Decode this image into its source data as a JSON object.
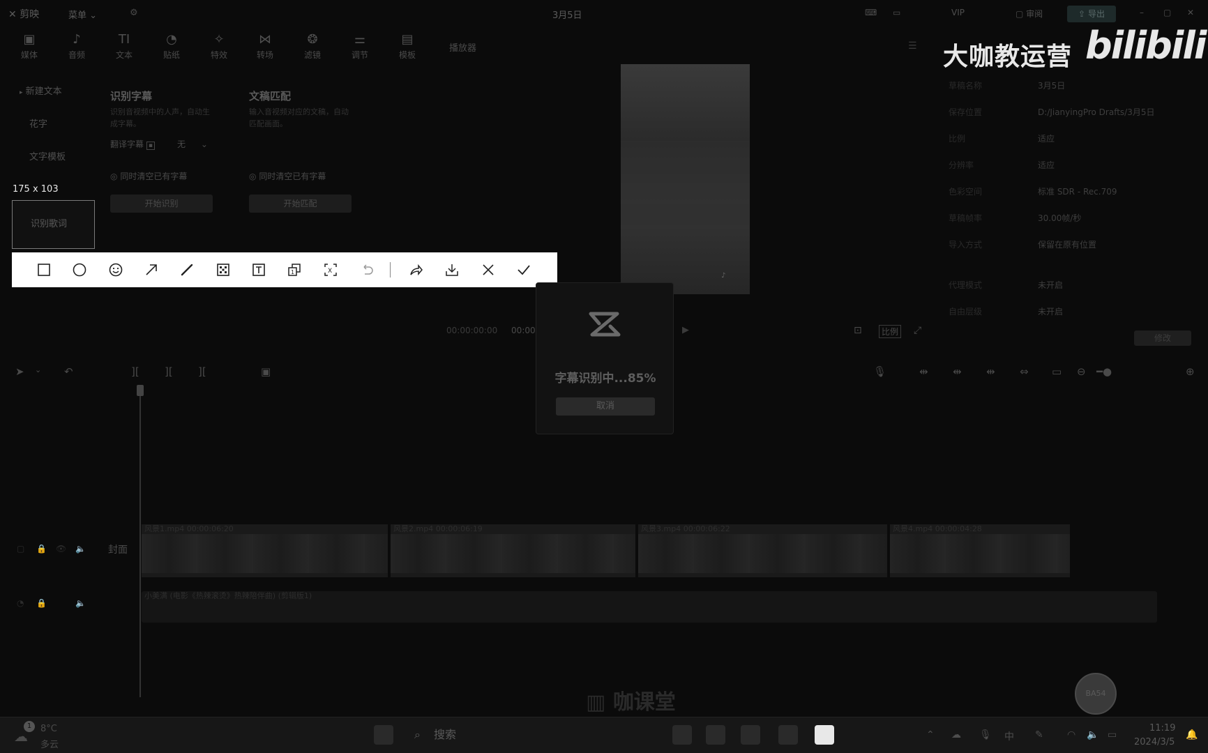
{
  "topbar": {
    "app_name": "剪映",
    "menu": "菜单",
    "title": "3月5日",
    "vip": "VIP",
    "review": "审阅",
    "export": "导出"
  },
  "tool_tabs": [
    {
      "label": "媒体",
      "glyph": "▣"
    },
    {
      "label": "音频",
      "glyph": "♪"
    },
    {
      "label": "文本",
      "glyph": "TI"
    },
    {
      "label": "贴纸",
      "glyph": "◔"
    },
    {
      "label": "特效",
      "glyph": "✧"
    },
    {
      "label": "转场",
      "glyph": "⋈"
    },
    {
      "label": "滤镜",
      "glyph": "❂"
    },
    {
      "label": "调节",
      "glyph": "⚌"
    },
    {
      "label": "模板",
      "glyph": "▤"
    }
  ],
  "player_label": "播放器",
  "left_nav": {
    "new_text": "新建文本",
    "fancy_text": "花字",
    "text_template": "文字模板",
    "lyrics": "识别歌词"
  },
  "screenshot": {
    "size_label": "175 x 103"
  },
  "subtitle_panel": {
    "title": "识别字幕",
    "desc": "识别音视频中的人声，自动生成字幕。",
    "translate_label": "翻译字幕",
    "translate_value": "无",
    "clear_label": "同时清空已有字幕",
    "start_btn": "开始识别"
  },
  "manuscript_panel": {
    "title": "文稿匹配",
    "desc": "输入音视频对应的文稿，自动匹配画面。",
    "clear_label": "同时清空已有字幕",
    "start_btn": "开始匹配"
  },
  "player": {
    "time_current": "00:00:00:00",
    "time_total": "00:00",
    "ratio": "比例"
  },
  "watermark": {
    "text": "大咖教运营",
    "logo": "bilibili",
    "bottom": "咖课堂"
  },
  "info_panel": {
    "rows": [
      {
        "key": "草稿名称",
        "value": "3月5日"
      },
      {
        "key": "保存位置",
        "value": "D:/JianyingPro Drafts/3月5日"
      },
      {
        "key": "比例",
        "value": "适应"
      },
      {
        "key": "分辨率",
        "value": "适应"
      },
      {
        "key": "色彩空间",
        "value": "标准 SDR - Rec.709"
      },
      {
        "key": "草稿帧率",
        "value": "30.00帧/秒"
      },
      {
        "key": "导入方式",
        "value": "保留在原有位置"
      },
      {
        "key": "代理模式",
        "value": "未开启"
      },
      {
        "key": "自由层级",
        "value": "未开启"
      }
    ],
    "modify_btn": "修改"
  },
  "dialog": {
    "progress_text": "字幕识别中...85%",
    "progress": 0.85,
    "cancel": "取消"
  },
  "timeline": {
    "cover_label": "封面",
    "clips": [
      {
        "name": "风景1.mp4",
        "duration": "00:00:06:20"
      },
      {
        "name": "风景2.mp4",
        "duration": "00:00:06:19"
      },
      {
        "name": "风景3.mp4",
        "duration": "00:00:06:22"
      },
      {
        "name": "风景4.mp4",
        "duration": "00:00:04:28"
      }
    ],
    "audio_label": "小美满 (电影《热辣滚烫》热辣陪伴曲) (剪辑版1)"
  },
  "avatar_text": "BA54",
  "taskbar": {
    "weather_badge": "1",
    "temperature": "8°C",
    "weather": "多云",
    "search": "搜索",
    "ime": "中",
    "time": "11:19",
    "date": "2024/3/5"
  }
}
